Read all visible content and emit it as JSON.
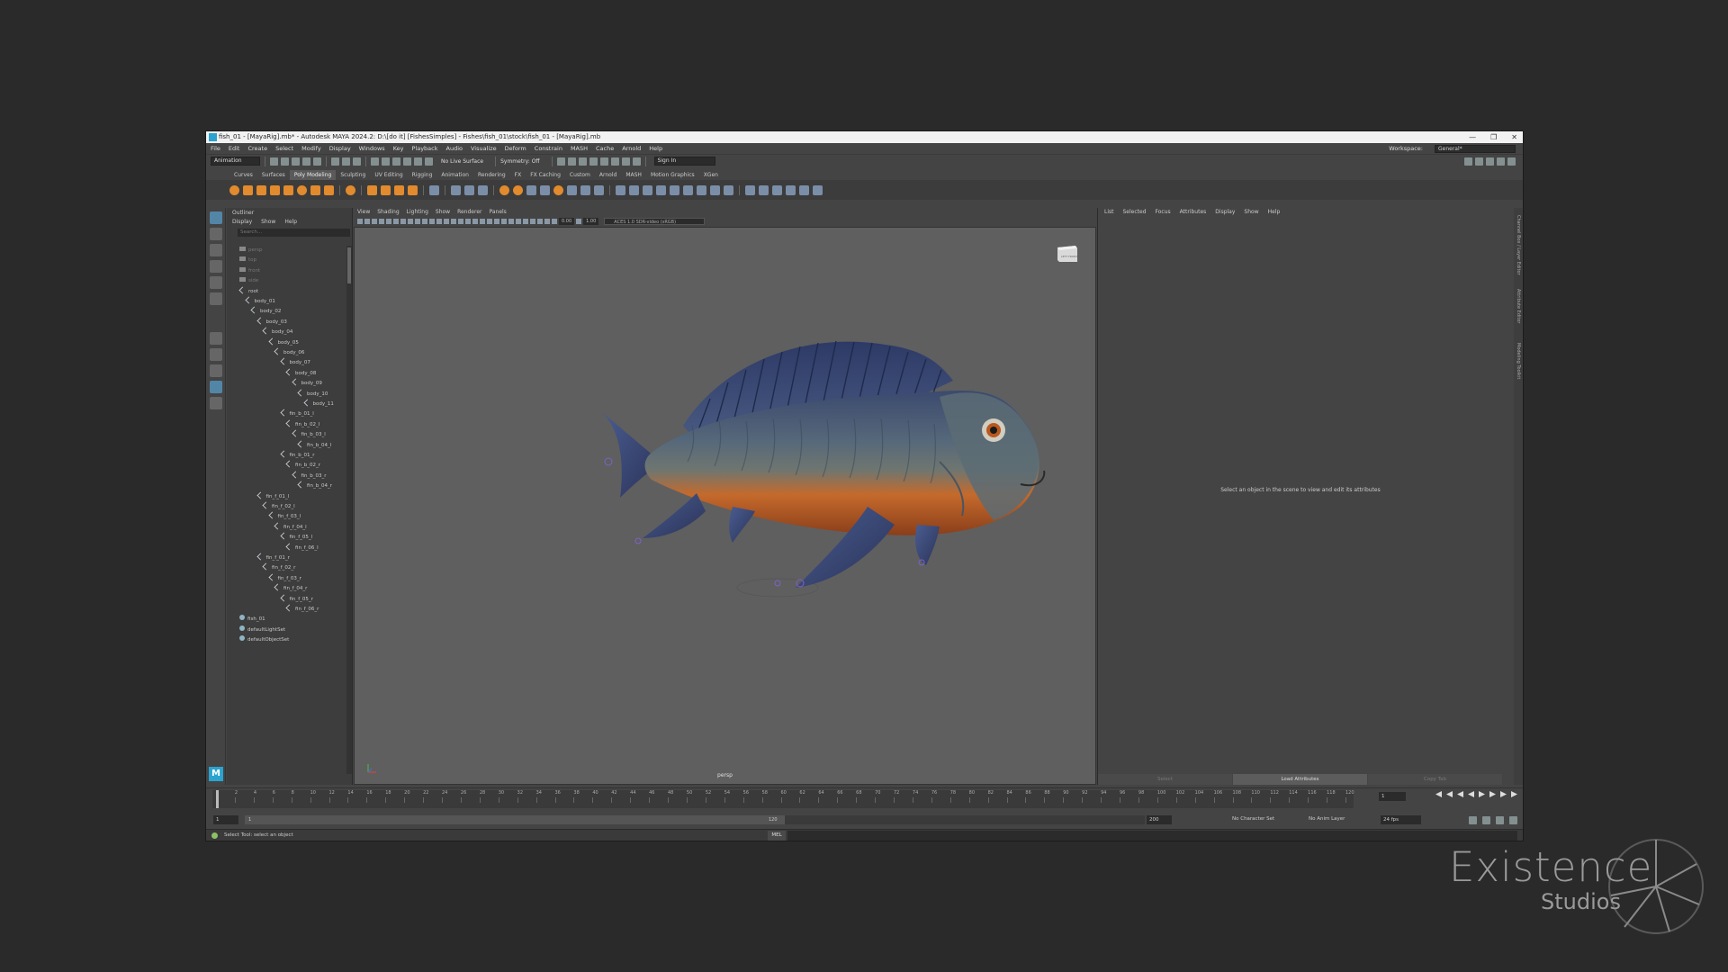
{
  "window": {
    "title": "fish_01 - [MayaRig].mb* - Autodesk MAYA 2024.2: D:\\[do it] [FishesSimples] - Fishes\\fish_01\\stock\\fish_01 - [MayaRig].mb",
    "controls": [
      "—",
      "❐",
      "✕"
    ]
  },
  "menubar": {
    "items": [
      "File",
      "Edit",
      "Create",
      "Select",
      "Modify",
      "Display",
      "Windows",
      "Key",
      "Playback",
      "Audio",
      "Visualize",
      "Deform",
      "Constrain",
      "MASH",
      "Cache",
      "Arnold",
      "Help"
    ],
    "workspace_label": "Workspace:",
    "workspace_value": "General*"
  },
  "statusline": {
    "menuset": "Animation",
    "live_surface": "No Live Surface",
    "symmetry": "Symmetry: Off",
    "sign_in": "Sign In"
  },
  "shelf": {
    "tabs": [
      "Curves",
      "Surfaces",
      "Poly Modeling",
      "Sculpting",
      "UV Editing",
      "Rigging",
      "Animation",
      "Rendering",
      "FX",
      "FX Caching",
      "Custom",
      "Arnold",
      "MASH",
      "Motion Graphics",
      "XGen"
    ],
    "active_tab": "Poly Modeling"
  },
  "outliner": {
    "title": "Outliner",
    "menu": [
      "Display",
      "Show",
      "Help"
    ],
    "search_placeholder": "Search...",
    "items": [
      {
        "label": "persp",
        "type": "cam",
        "depth": 0
      },
      {
        "label": "top",
        "type": "cam",
        "depth": 0
      },
      {
        "label": "front",
        "type": "cam",
        "depth": 0
      },
      {
        "label": "side",
        "type": "cam",
        "depth": 0
      },
      {
        "label": "root",
        "type": "joint",
        "depth": 0
      },
      {
        "label": "body_01",
        "type": "joint",
        "depth": 1
      },
      {
        "label": "body_02",
        "type": "joint",
        "depth": 2
      },
      {
        "label": "body_03",
        "type": "joint",
        "depth": 3
      },
      {
        "label": "body_04",
        "type": "joint",
        "depth": 4
      },
      {
        "label": "body_05",
        "type": "joint",
        "depth": 5
      },
      {
        "label": "body_06",
        "type": "joint",
        "depth": 6
      },
      {
        "label": "body_07",
        "type": "joint",
        "depth": 7
      },
      {
        "label": "body_08",
        "type": "joint",
        "depth": 8
      },
      {
        "label": "body_09",
        "type": "joint",
        "depth": 9
      },
      {
        "label": "body_10",
        "type": "joint",
        "depth": 10
      },
      {
        "label": "body_11",
        "type": "joint",
        "depth": 11
      },
      {
        "label": "fin_b_01_l",
        "type": "joint",
        "depth": 7
      },
      {
        "label": "fin_b_02_l",
        "type": "joint",
        "depth": 8
      },
      {
        "label": "fin_b_03_l",
        "type": "joint",
        "depth": 9
      },
      {
        "label": "fin_b_04_l",
        "type": "joint",
        "depth": 10
      },
      {
        "label": "fin_b_01_r",
        "type": "joint",
        "depth": 7
      },
      {
        "label": "fin_b_02_r",
        "type": "joint",
        "depth": 8
      },
      {
        "label": "fin_b_03_r",
        "type": "joint",
        "depth": 9
      },
      {
        "label": "fin_b_04_r",
        "type": "joint",
        "depth": 10
      },
      {
        "label": "fin_f_01_l",
        "type": "joint",
        "depth": 3
      },
      {
        "label": "fin_f_02_l",
        "type": "joint",
        "depth": 4
      },
      {
        "label": "fin_f_03_l",
        "type": "joint",
        "depth": 5
      },
      {
        "label": "fin_f_04_l",
        "type": "joint",
        "depth": 6
      },
      {
        "label": "fin_f_05_l",
        "type": "joint",
        "depth": 7
      },
      {
        "label": "fin_f_06_l",
        "type": "joint",
        "depth": 8
      },
      {
        "label": "fin_f_01_r",
        "type": "joint",
        "depth": 3
      },
      {
        "label": "fin_f_02_r",
        "type": "joint",
        "depth": 4
      },
      {
        "label": "fin_f_03_r",
        "type": "joint",
        "depth": 5
      },
      {
        "label": "fin_f_04_r",
        "type": "joint",
        "depth": 6
      },
      {
        "label": "fin_f_05_r",
        "type": "joint",
        "depth": 7
      },
      {
        "label": "fin_f_06_r",
        "type": "joint",
        "depth": 8
      },
      {
        "label": "fish_01",
        "type": "mesh",
        "depth": 0
      },
      {
        "label": "defaultLightSet",
        "type": "set",
        "depth": 0
      },
      {
        "label": "defaultObjectSet",
        "type": "set",
        "depth": 0
      }
    ]
  },
  "viewport": {
    "menu": [
      "View",
      "Shading",
      "Lighting",
      "Show",
      "Renderer",
      "Panels"
    ],
    "exposure": "0.00",
    "gamma": "1.00",
    "color_space": "ACES 1.0 SDR-video (sRGB)",
    "camera_label": "persp",
    "viewcube_left": "LEFT",
    "viewcube_front": "FRONT"
  },
  "attribute_editor": {
    "menu": [
      "List",
      "Selected",
      "Focus",
      "Attributes",
      "Display",
      "Show",
      "Help"
    ],
    "message": "Select an object in the scene to view and edit its attributes",
    "buttons": [
      "Select",
      "Load Attributes",
      "Copy Tab"
    ],
    "side_tabs": [
      "Channel Box / Layer Editor",
      "Attribute Editor",
      "Modeling Toolkit"
    ]
  },
  "timeslider": {
    "ticks": [
      "1",
      "2",
      "4",
      "6",
      "8",
      "10",
      "12",
      "14",
      "16",
      "18",
      "20",
      "22",
      "24",
      "26",
      "28",
      "30",
      "32",
      "34",
      "36",
      "38",
      "40",
      "42",
      "44",
      "46",
      "48",
      "50",
      "52",
      "54",
      "56",
      "58",
      "60",
      "62",
      "64",
      "66",
      "68",
      "70",
      "72",
      "74",
      "76",
      "78",
      "80",
      "82",
      "84",
      "86",
      "88",
      "90",
      "92",
      "94",
      "96",
      "98",
      "100",
      "102",
      "104",
      "106",
      "108",
      "110",
      "112",
      "114",
      "116",
      "118",
      "120"
    ],
    "current_frame": "1"
  },
  "range": {
    "start": "1",
    "inner_start": "1",
    "inner_end": "120",
    "end": "200",
    "character_set": "No Character Set",
    "anim_layer": "No Anim Layer",
    "fps": "24 fps"
  },
  "helpline": {
    "text": "Select Tool: select an object",
    "mel_label": "MEL"
  },
  "watermark": {
    "line1": "Existence",
    "line2": "Studios"
  },
  "colors": {
    "accent": "#2aa3d0",
    "shelf_icon": "#e18a2e",
    "fish_belly": "#c9692a",
    "fish_back": "#3d4f74"
  }
}
